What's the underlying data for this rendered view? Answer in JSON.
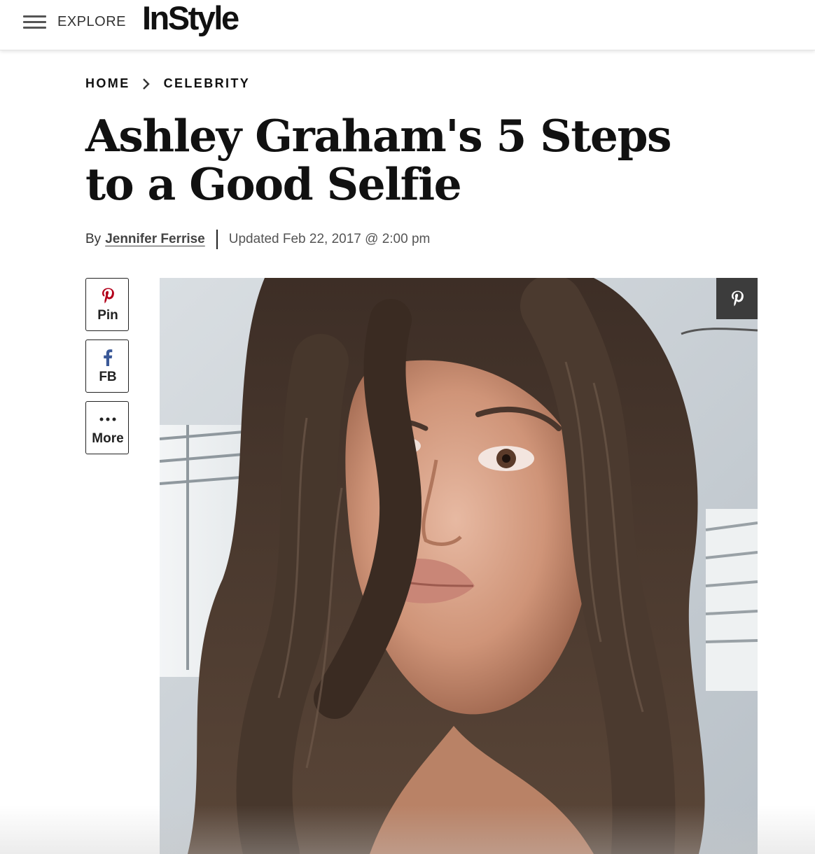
{
  "header": {
    "explore_label": "EXPLORE",
    "logo_text": "InStyle"
  },
  "breadcrumb": {
    "items": [
      {
        "label": "HOME"
      },
      {
        "label": "CELEBRITY"
      }
    ]
  },
  "article": {
    "title": "Ashley Graham's 5 Steps to a Good Selfie",
    "byline_prefix": "By",
    "author": "Jennifer Ferrise",
    "updated": "Updated Feb 22, 2017 @ 2:00 pm"
  },
  "share": {
    "pin_label": "Pin",
    "fb_label": "FB",
    "more_label": "More",
    "pin_icon": "pinterest-icon",
    "fb_icon": "facebook-icon",
    "more_icon": "ellipsis-icon"
  },
  "colors": {
    "pinterest": "#b3001b",
    "facebook": "#3b5998",
    "pin_overlay_bg": "#3c3c3c"
  }
}
